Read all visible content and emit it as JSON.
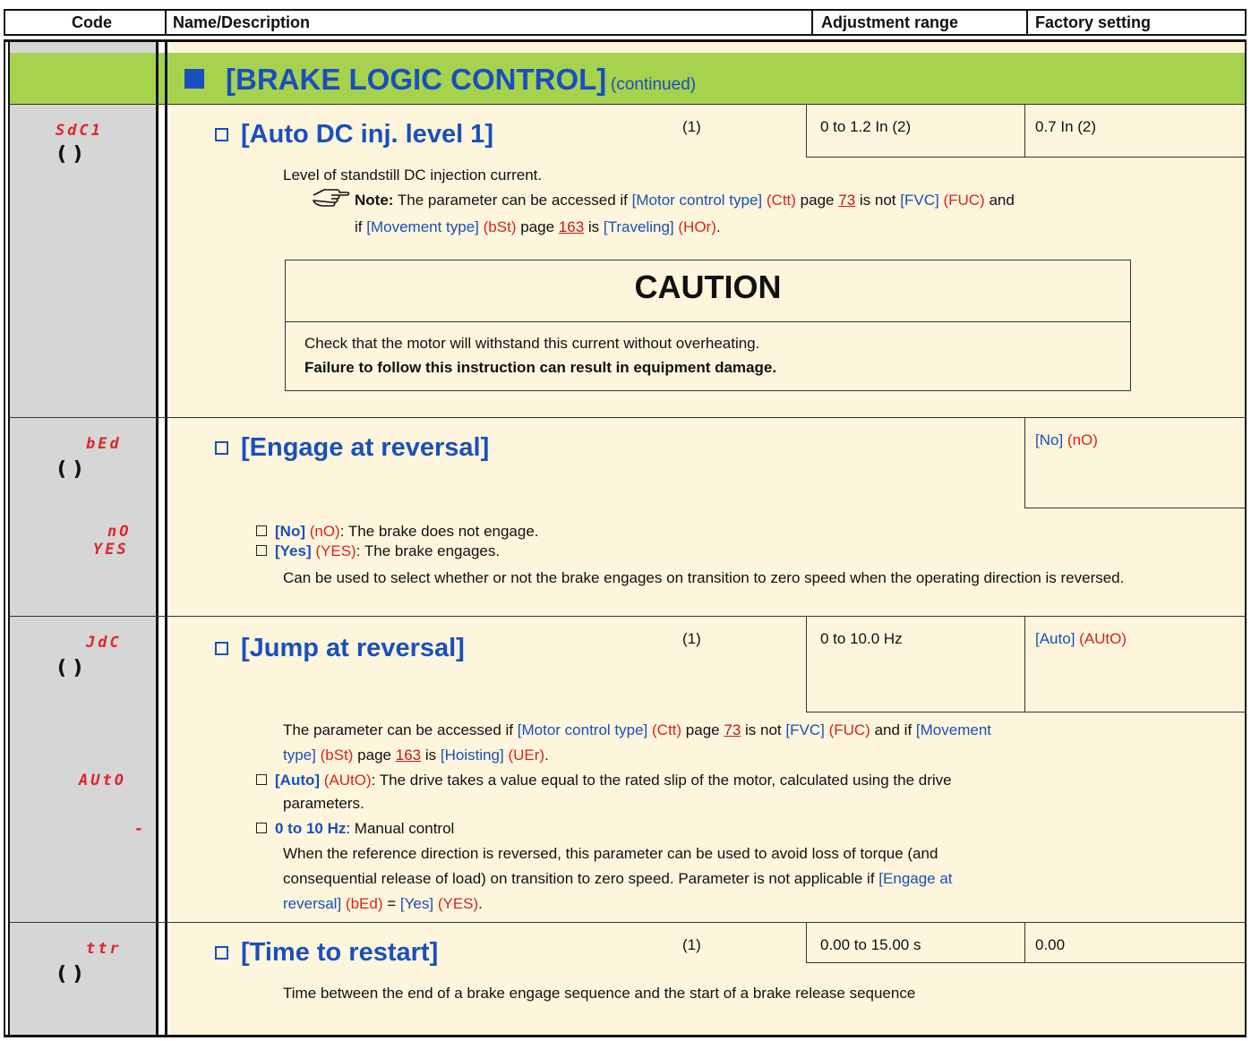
{
  "header": {
    "code": "Code",
    "name": "Name/Description",
    "range": "Adjustment range",
    "factory": "Factory setting"
  },
  "section": {
    "title": "[BRAKE LOGIC CONTROL]",
    "suffix": "(continued)"
  },
  "params": [
    {
      "code": "SdC1",
      "title": "[Auto DC inj. level 1]",
      "note_ref": "(1)",
      "range": "0 to 1.2 In (2)",
      "factory": "0.7 In (2)",
      "desc": "Level of standstill DC injection current.",
      "note": {
        "label": "Note:",
        "t1": "The parameter can be accessed if",
        "p1": "[Motor control type]",
        "c1": "(Ctt)",
        "t2": "page",
        "link1": "73",
        "t3": "is not",
        "v1": "[FVC]",
        "c2": "(FUC)",
        "t4": "and",
        "t5": "if",
        "p2": "[Movement type]",
        "c3": "(bSt)",
        "t6": "page",
        "link2": "163",
        "t7": "is",
        "v2": "[Traveling]",
        "c4": "(HOr)",
        "end": "."
      },
      "caution": {
        "title": "CAUTION",
        "line1": "Check that the motor will withstand this current without overheating.",
        "line2": "Failure to follow this instruction can result in equipment damage."
      }
    },
    {
      "code": "bEd",
      "title": "[Engage at reversal]",
      "factory_param": "[No]",
      "factory_code": "(nO)",
      "options": [
        {
          "code": "nO",
          "label": "[No]",
          "abbr": "(nO)",
          "text": ": The brake does not engage."
        },
        {
          "code": "YES",
          "label": "[Yes]",
          "abbr": "(YES)",
          "text": ": The brake engages."
        }
      ],
      "desc": "Can be used to select whether or not the brake engages on transition to zero speed when the operating direction is reversed."
    },
    {
      "code": "JdC",
      "title": "[Jump at reversal]",
      "note_ref": "(1)",
      "range": "0 to 10.0 Hz",
      "factory_param": "[Auto]",
      "factory_code": "(AUtO)",
      "access": {
        "t1": "The parameter can be accessed if",
        "p1": "[Motor control type]",
        "c1": "(Ctt)",
        "t2": "page",
        "link1": "73",
        "t3": "is not",
        "v1": "[FVC]",
        "c2": "(FUC)",
        "t4": "and if",
        "p2": "[Movement",
        "p2b": "type]",
        "c3": "(bSt)",
        "t5": "page",
        "link2": "163",
        "t6": "is",
        "v2": "[Hoisting]",
        "c4": "(UEr)",
        "end": "."
      },
      "options": [
        {
          "code": "AUtO",
          "label": "[Auto]",
          "abbr": "(AUtO)",
          "text": ": The drive takes a value equal to the rated slip of the motor, calculated using the drive",
          "text2": "parameters."
        },
        {
          "code": "-",
          "label": "0 to 10 Hz",
          "text": ": Manual control"
        }
      ],
      "desc1": "When the reference direction is reversed, this parameter can be used to avoid loss of torque (and",
      "desc2": "consequential release of load) on transition to zero speed. Parameter is not applicable if",
      "desc2_p": "[Engage at",
      "desc3_p": "reversal]",
      "desc3_c": "(bEd)",
      "desc3_eq": "=",
      "desc3_v": "[Yes]",
      "desc3_vc": "(YES)",
      "desc3_end": "."
    },
    {
      "code": "ttr",
      "title": "[Time to restart]",
      "note_ref": "(1)",
      "range": "0.00 to 15.00 s",
      "factory": "0.00",
      "desc": "Time between the end of a brake engage sequence and the start of a brake release sequence"
    }
  ],
  "colors": {
    "section_green": "#a6d24e",
    "row_cream": "#fdf6dc",
    "code_grey": "#d6d6d6",
    "param_blue": "#1a4fbd",
    "code_red": "#e0242a"
  }
}
